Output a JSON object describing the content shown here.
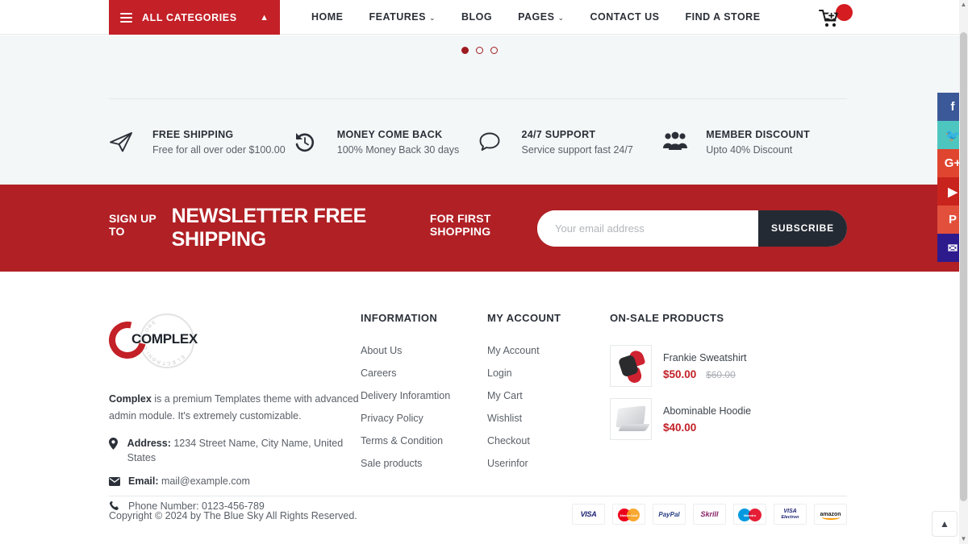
{
  "nav": {
    "categories_label": "ALL CATEGORIES",
    "categories_caret": "▲",
    "items": [
      {
        "label": "HOME",
        "caret": ""
      },
      {
        "label": "FEATURES",
        "caret": "⌄"
      },
      {
        "label": "BLOG",
        "caret": ""
      },
      {
        "label": "PAGES",
        "caret": "⌄"
      },
      {
        "label": "CONTACT US",
        "caret": ""
      },
      {
        "label": "FIND A STORE",
        "caret": ""
      }
    ]
  },
  "carousel": {
    "dots": 3,
    "active": 0
  },
  "services": [
    {
      "icon": "paper-plane-icon",
      "title": "FREE SHIPPING",
      "desc": "Free for all over oder $100.00"
    },
    {
      "icon": "rotate-left-icon",
      "title": "MONEY COME BACK",
      "desc": "100% Money Back 30 days"
    },
    {
      "icon": "chat-bubble-icon",
      "title": "24/7 SUPPORT",
      "desc": "Service support fast 24/7"
    },
    {
      "icon": "users-group-icon",
      "title": "MEMBER DISCOUNT",
      "desc": "Upto 40% Discount"
    }
  ],
  "newsletter": {
    "lead": "SIGN UP TO",
    "highlight": "NEWSLETTER FREE SHIPPING",
    "trail": "FOR FIRST SHOPPING",
    "placeholder": "Your email address",
    "value": "",
    "button": "SUBSCRIBE",
    "bg_color": "#b02025"
  },
  "footer": {
    "logo": {
      "brand": "COMPLEX",
      "ring_text": "ELECTRONIC STORE"
    },
    "about": {
      "lead": "Complex",
      "text": " is a premium Templates theme with advanced admin module. It's extremely customizable."
    },
    "contacts": [
      {
        "icon": "map-pin-icon",
        "label": "Address:",
        "value": " 1234 Street Name, City Name, United States"
      },
      {
        "icon": "envelope-icon",
        "label": "Email:",
        "value": " mail@example.com"
      },
      {
        "icon": "phone-icon",
        "label": "",
        "value": "Phone Number: 0123-456-789"
      }
    ],
    "information": {
      "title": "INFORMATION",
      "links": [
        "About Us",
        "Careers",
        "Delivery Inforamtion",
        "Privacy Policy",
        "Terms & Condition",
        "Sale products"
      ]
    },
    "my_account": {
      "title": "MY ACCOUNT",
      "links": [
        "My Account",
        "Login",
        "My Cart",
        "Wishlist",
        "Checkout",
        "Userinfor"
      ]
    },
    "on_sale": {
      "title": "ON-SALE PRODUCTS",
      "products": [
        {
          "name": "Frankie Sweatshirt",
          "price": "$50.00",
          "old_price": "$60.00",
          "thumb": "red-smartwatch"
        },
        {
          "name": "Abominable Hoodie",
          "price": "$40.00",
          "old_price": "",
          "thumb": "silver-laptop"
        }
      ]
    },
    "copyright": "Copyright © 2024 by The Blue Sky All Rights Reserved.",
    "payments": [
      {
        "name": "visa",
        "label": "VISA"
      },
      {
        "name": "mastercard",
        "label": "MasterCard"
      },
      {
        "name": "paypal",
        "label": "PayPal"
      },
      {
        "name": "skrill",
        "label": "Skrill"
      },
      {
        "name": "maestro",
        "label": "Maestro"
      },
      {
        "name": "visa-electron",
        "label1": "VISA",
        "label2": "Electron"
      },
      {
        "name": "amazon",
        "label": "amazon"
      }
    ]
  },
  "social": [
    {
      "name": "facebook",
      "glyph": "f",
      "color": "#3b5998"
    },
    {
      "name": "twitter",
      "glyph": "🐦",
      "color": "#4ec6c0"
    },
    {
      "name": "google-plus",
      "glyph": "G+",
      "color": "#e0452f"
    },
    {
      "name": "youtube",
      "glyph": "▶",
      "color": "#c8241d"
    },
    {
      "name": "pinterest",
      "glyph": "P",
      "color": "#e2503c"
    },
    {
      "name": "email",
      "glyph": "✉",
      "color": "#2d1b8e"
    }
  ],
  "back_to_top": "▲"
}
